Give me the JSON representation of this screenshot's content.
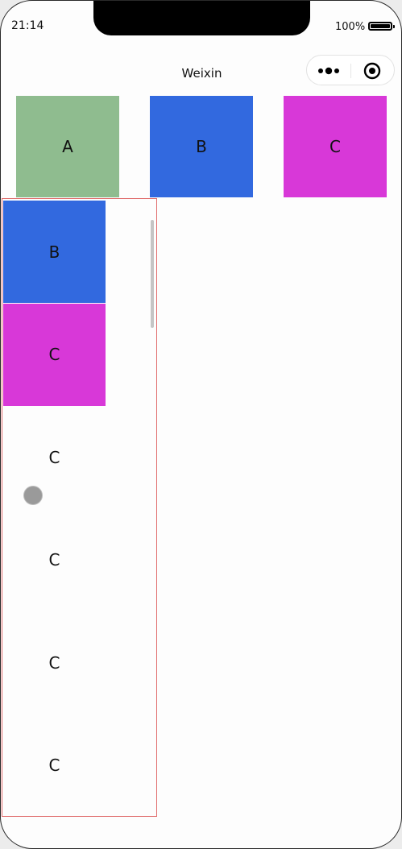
{
  "status_bar": {
    "time": "21:14",
    "battery_percent": "100%"
  },
  "nav_bar": {
    "title": "Weixin"
  },
  "capsule": {
    "more_icon": "more-dots-icon",
    "close_icon": "target-circle-icon"
  },
  "top_row": [
    {
      "label": "A",
      "color": "#8fbc8f"
    },
    {
      "label": "B",
      "color": "#3269df"
    },
    {
      "label": "C",
      "color": "#d838d8"
    }
  ],
  "scroll_list": [
    {
      "label": "B",
      "color": "#3269df"
    },
    {
      "label": "C",
      "color": "#d838d8"
    },
    {
      "label": "C",
      "color": "transparent"
    },
    {
      "label": "C",
      "color": "transparent"
    },
    {
      "label": "C",
      "color": "transparent"
    },
    {
      "label": "C",
      "color": "transparent"
    }
  ],
  "colors": {
    "frame_border": "#e06a6a",
    "touch_indicator": "#9a9a9a"
  }
}
